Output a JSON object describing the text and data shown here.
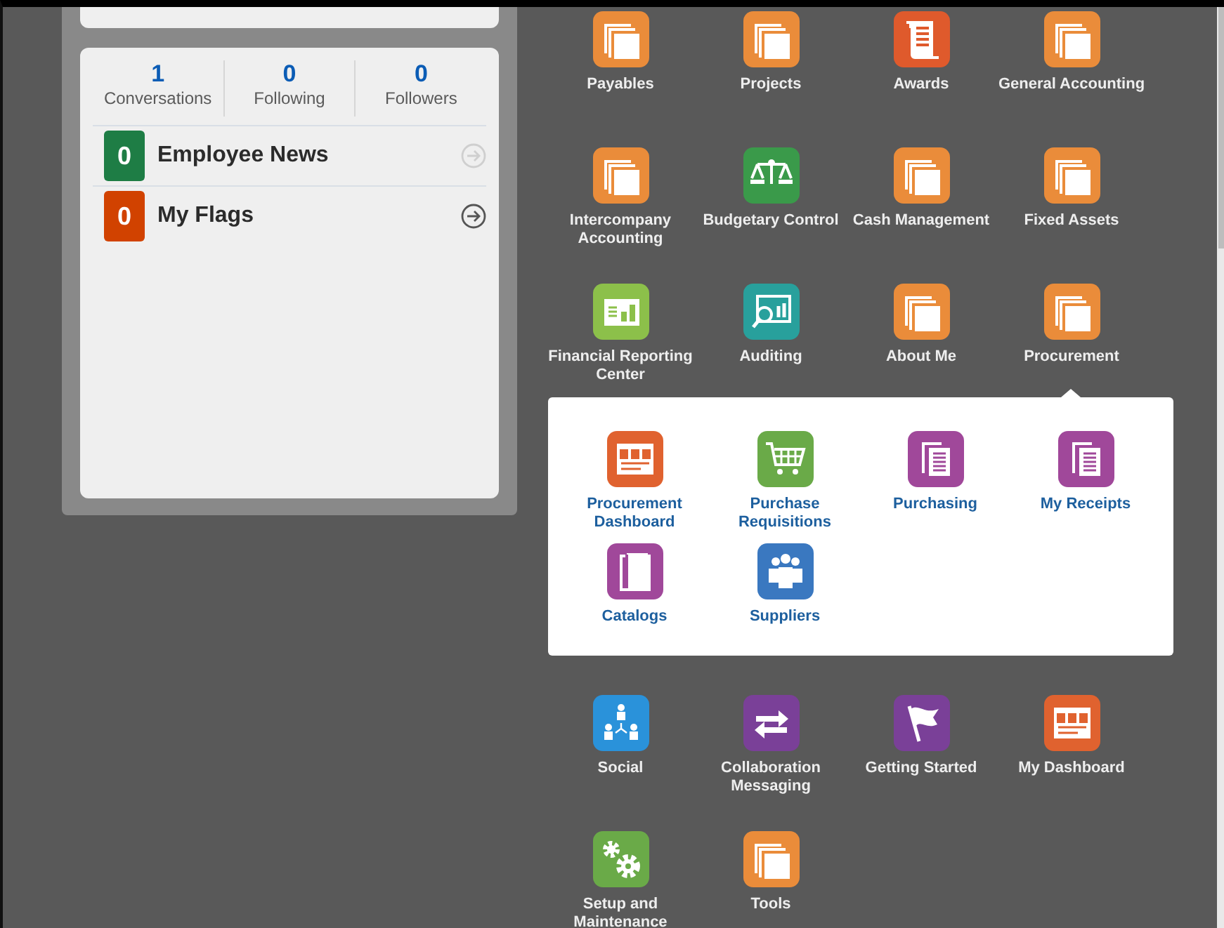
{
  "stats": [
    {
      "count": "1",
      "label": "Conversations"
    },
    {
      "count": "0",
      "label": "Following"
    },
    {
      "count": "0",
      "label": "Followers"
    }
  ],
  "feeds": [
    {
      "count": "0",
      "color": "#1e7d45",
      "label": "Employee News",
      "disabled": true
    },
    {
      "count": "0",
      "color": "#d14200",
      "label": "My Flags",
      "disabled": false
    }
  ],
  "apps": [
    {
      "kind": "pages",
      "label": "Payables"
    },
    {
      "kind": "pages",
      "label": "Projects"
    },
    {
      "kind": "scroll",
      "label": "Awards"
    },
    {
      "kind": "pages",
      "label": "General Accounting"
    },
    {
      "kind": "pages",
      "label": "Intercompany Accounting"
    },
    {
      "kind": "scales",
      "label": "Budgetary Control"
    },
    {
      "kind": "pages",
      "label": "Cash Management"
    },
    {
      "kind": "pages",
      "label": "Fixed Assets"
    },
    {
      "kind": "report",
      "label": "Financial Reporting Center"
    },
    {
      "kind": "audit",
      "label": "Auditing"
    },
    {
      "kind": "pages",
      "label": "About Me"
    },
    {
      "kind": "pages",
      "label": "Procurement",
      "expanded": true
    }
  ],
  "procurement_menu": [
    {
      "kind": "dashboard",
      "label": "Procurement Dashboard"
    },
    {
      "kind": "cart",
      "label": "Purchase Requisitions"
    },
    {
      "kind": "document",
      "label": "Purchasing"
    },
    {
      "kind": "document",
      "label": "My Receipts"
    },
    {
      "kind": "book",
      "label": "Catalogs"
    },
    {
      "kind": "people",
      "label": "Suppliers"
    }
  ],
  "more_apps": [
    {
      "kind": "social",
      "label": "Social"
    },
    {
      "kind": "arrows",
      "label": "Collaboration Messaging"
    },
    {
      "kind": "flag",
      "label": "Getting Started"
    },
    {
      "kind": "dashboard",
      "label": "My Dashboard"
    },
    {
      "kind": "gears",
      "label": "Setup and Maintenance"
    },
    {
      "kind": "pages",
      "label": "Tools"
    }
  ]
}
